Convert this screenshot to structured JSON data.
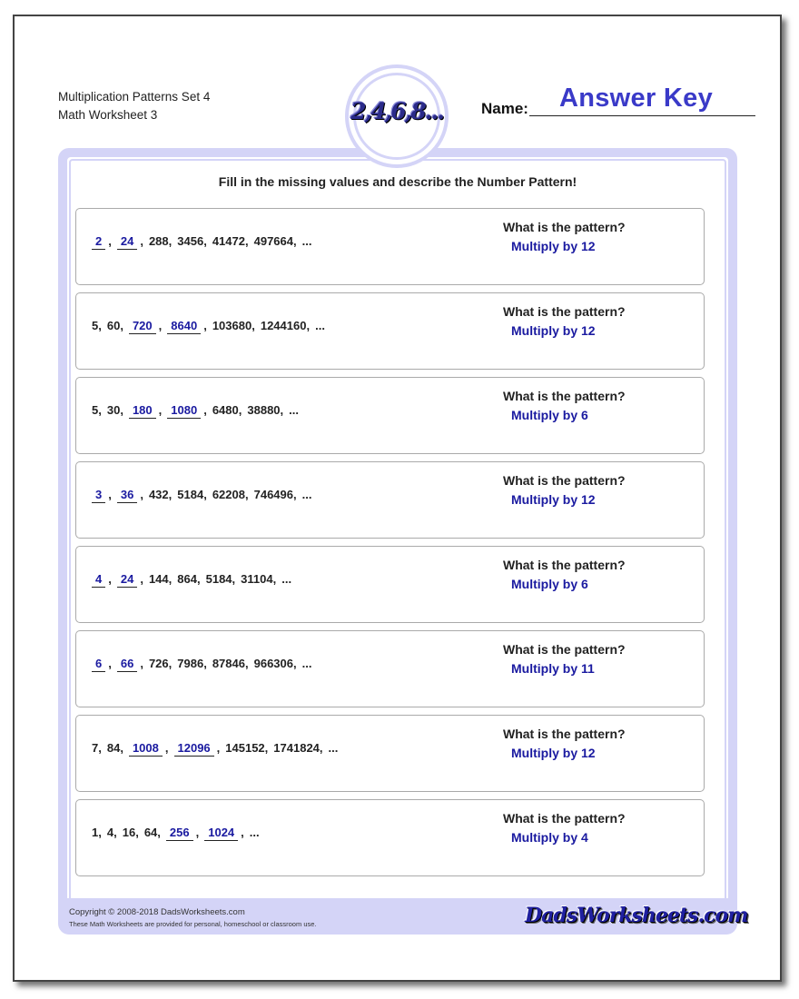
{
  "header": {
    "title_line1": "Multiplication Patterns Set 4",
    "title_line2": "Math Worksheet 3",
    "name_label": "Name:",
    "name_value": "Answer Key",
    "badge_text": "2,4,6,8..."
  },
  "instructions": "Fill in the missing values and describe the Number Pattern!",
  "question_label": "What is the pattern?",
  "problems": [
    {
      "terms": [
        {
          "v": "2",
          "blank": true
        },
        {
          "v": "24",
          "blank": true
        },
        {
          "v": "288"
        },
        {
          "v": "3456"
        },
        {
          "v": "41472"
        },
        {
          "v": "497664"
        },
        {
          "v": "..."
        }
      ],
      "answer": "Multiply by 12"
    },
    {
      "terms": [
        {
          "v": "5"
        },
        {
          "v": "60"
        },
        {
          "v": "720",
          "blank": true
        },
        {
          "v": "8640",
          "blank": true
        },
        {
          "v": "103680"
        },
        {
          "v": "1244160"
        },
        {
          "v": "..."
        }
      ],
      "answer": "Multiply by 12"
    },
    {
      "terms": [
        {
          "v": "5"
        },
        {
          "v": "30"
        },
        {
          "v": "180",
          "blank": true
        },
        {
          "v": "1080",
          "blank": true
        },
        {
          "v": "6480"
        },
        {
          "v": "38880"
        },
        {
          "v": "..."
        }
      ],
      "answer": "Multiply by 6"
    },
    {
      "terms": [
        {
          "v": "3",
          "blank": true
        },
        {
          "v": "36",
          "blank": true
        },
        {
          "v": "432"
        },
        {
          "v": "5184"
        },
        {
          "v": "62208"
        },
        {
          "v": "746496"
        },
        {
          "v": "..."
        }
      ],
      "answer": "Multiply by 12"
    },
    {
      "terms": [
        {
          "v": "4",
          "blank": true
        },
        {
          "v": "24",
          "blank": true
        },
        {
          "v": "144"
        },
        {
          "v": "864"
        },
        {
          "v": "5184"
        },
        {
          "v": "31104"
        },
        {
          "v": "..."
        }
      ],
      "answer": "Multiply by 6"
    },
    {
      "terms": [
        {
          "v": "6",
          "blank": true
        },
        {
          "v": "66",
          "blank": true
        },
        {
          "v": "726"
        },
        {
          "v": "7986"
        },
        {
          "v": "87846"
        },
        {
          "v": "966306"
        },
        {
          "v": "..."
        }
      ],
      "answer": "Multiply by 11"
    },
    {
      "terms": [
        {
          "v": "7"
        },
        {
          "v": "84"
        },
        {
          "v": "1008",
          "blank": true
        },
        {
          "v": "12096",
          "blank": true
        },
        {
          "v": "145152"
        },
        {
          "v": "1741824"
        },
        {
          "v": "..."
        }
      ],
      "answer": "Multiply by 12"
    },
    {
      "terms": [
        {
          "v": "1"
        },
        {
          "v": "4"
        },
        {
          "v": "16"
        },
        {
          "v": "64"
        },
        {
          "v": "256",
          "blank": true
        },
        {
          "v": "1024",
          "blank": true
        },
        {
          "v": "..."
        }
      ],
      "answer": "Multiply by 4"
    }
  ],
  "footer": {
    "copyright": "Copyright © 2008-2018 DadsWorksheets.com",
    "usage": "These Math Worksheets are provided for personal, homeschool or classroom use.",
    "logo_text": "DadsWorksheets.com"
  },
  "colors": {
    "frame": "#d4d4f7",
    "answer_blue": "#1a1aa0",
    "answer_key_blue": "#3a3ac8"
  }
}
